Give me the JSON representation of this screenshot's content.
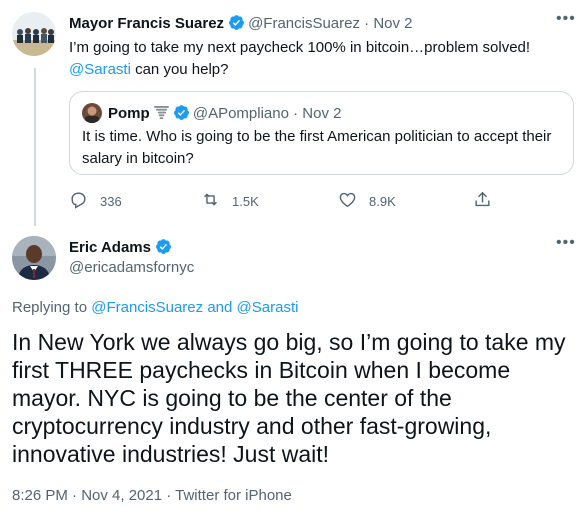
{
  "first_tweet": {
    "display_name": "Mayor Francis Suarez",
    "handle": "@FrancisSuarez",
    "separator": "·",
    "date": "Nov 2",
    "text_before": "I’m going to take my next paycheck 100% in bitcoin…problem solved! ",
    "mention": "@Sarasti",
    "text_after": " can you help?",
    "quote": {
      "display_name": "Pomp",
      "emoji_icon": "tornado-icon",
      "handle": "@APompliano",
      "separator": "·",
      "date": "Nov 2",
      "text": "It is time. Who is going to be the first American politician to accept their salary in bitcoin?"
    },
    "actions": {
      "replies": "336",
      "retweets": "1.5K",
      "likes": "8.9K"
    }
  },
  "second_tweet": {
    "display_name": "Eric Adams",
    "handle": "@ericadamsfornyc",
    "replying_label": "Replying to ",
    "reply_mention_1": "@FrancisSuarez",
    "reply_and": " and ",
    "reply_mention_2": "@Sarasti",
    "text": "In New York we always go big, so I’m going to take my first THREE paychecks in Bitcoin when I become mayor. NYC is going to be the center of the cryptocurrency industry and other fast-growing, innovative industries! Just wait!",
    "meta": "8:26 PM · Nov 4, 2021 · Twitter for iPhone"
  },
  "colors": {
    "accent": "#1d9bf0",
    "muted": "#536471",
    "border": "#cfd9de"
  }
}
